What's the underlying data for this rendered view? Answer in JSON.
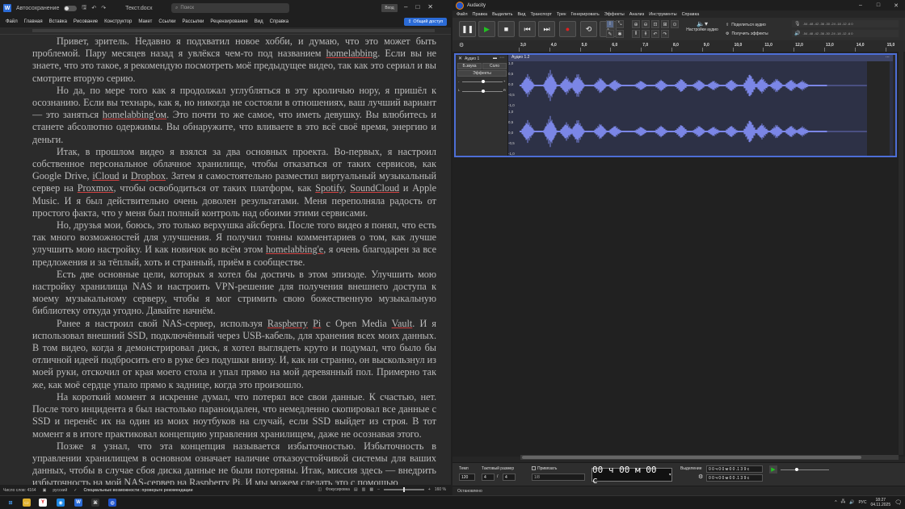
{
  "word": {
    "autosave_label": "Автосохранение",
    "doc_name": "Текст.docx",
    "search_placeholder": "Поиск",
    "signin_label": "Вход",
    "menu": [
      "Файл",
      "Главная",
      "Вставка",
      "Рисование",
      "Конструктор",
      "Макет",
      "Ссылки",
      "Рассылки",
      "Рецензирование",
      "Вид",
      "Справка"
    ],
    "share_label": "Общий доступ",
    "paragraphs": [
      [
        {
          "t": "Привет, зритель. Недавно я подхватил новое хобби, и думаю, что это может быть проблемой. Пару месяцев назад я увлёкся чем-то под названием "
        },
        {
          "t": "homelabbing",
          "s": 1
        },
        {
          "t": ". Если вы не знаете, что это такое, я рекомендую посмотреть моё предыдущее видео, так как это сериал и вы смотрите вторую серию."
        }
      ],
      [
        {
          "t": "Но да, по мере того как я продолжал углубляться в эту кроличью нору, я пришёл к осознанию. Если вы технарь, как я, но никогда не состояли в отношениях, ваш лучший вариант — это заняться "
        },
        {
          "t": "homelabbing'ом",
          "s": 1
        },
        {
          "t": ". Это почти то же самое, что иметь девушку. Вы влюбитесь и станете абсолютно одержимы. Вы обнаружите, что вливаете в это всё своё время, энергию и деньги."
        }
      ],
      [
        {
          "t": "Итак, в прошлом видео я взялся за два основных проекта. Во-первых, я настроил собственное персональное облачное хранилище, чтобы отказаться от таких сервисов, как Google Drive, "
        },
        {
          "t": "iCloud",
          "s": 1
        },
        {
          "t": " и "
        },
        {
          "t": "Dropbox",
          "s": 1
        },
        {
          "t": ". Затем я самостоятельно разместил виртуальный музыкальный сервер на "
        },
        {
          "t": "Proxmox",
          "s": 1
        },
        {
          "t": ", чтобы освободиться от таких платформ, как "
        },
        {
          "t": "Spotify",
          "s": 1
        },
        {
          "t": ", "
        },
        {
          "t": "SoundCloud",
          "s": 1
        },
        {
          "t": " и Apple Music. И я был действительно очень доволен результатами. Меня переполняла радость от простого факта, что у меня был полный контроль над обоими этими сервисами."
        }
      ],
      [
        {
          "t": "Но, друзья мои, боюсь, это только верхушка айсберга. После того видео я понял, что есть так много возможностей для улучшения. Я получил тонны комментариев о том, как лучше улучшить мою настройку. И как новичок во всём этом "
        },
        {
          "t": "homelabbing'е",
          "s": 1
        },
        {
          "t": ", я очень благодарен за все предложения и за тёплый, хоть и странный, приём в сообществе."
        }
      ],
      [
        {
          "t": "Есть две основные цели, которых я хотел бы достичь в этом эпизоде. Улучшить мою настройку хранилища NAS и настроить VPN-решение для получения внешнего доступа к моему музыкальному серверу, чтобы я мог стримить свою божественную музыкальную библиотеку откуда угодно. Давайте начнём."
        }
      ],
      [
        {
          "t": "Ранее я настроил свой NAS-сервер, используя "
        },
        {
          "t": "Raspberry",
          "s": 1
        },
        {
          "t": " "
        },
        {
          "t": "Pi",
          "s": 1
        },
        {
          "t": " с Open Media "
        },
        {
          "t": "Vault",
          "s": 1
        },
        {
          "t": ". И я использовал внешний SSD, подключённый через USB-кабель, для хранения всех моих данных. В том видео, когда я демонстрировал диск, я хотел выглядеть круто и подумал, что было бы отличной идеей подбросить его в руке без подушки внизу. И, как ни странно, он выскользнул из моей руки, отскочил от края моего стола и упал прямо на мой деревянный пол. Примерно так же, как моё сердце упало прямо к заднице, когда это произошло."
        }
      ],
      [
        {
          "t": "На короткий момент я искренне думал, что потерял все свои данные. К счастью, нет. После того инцидента я был настолько параноидален, что немедленно скопировал все данные с SSD и перенёс их на один из моих ноутбуков на случай, если SSD выйдет из строя. В тот момент я в итоге практиковал концепцию управления хранилищем, даже не осознавая этого."
        }
      ],
      [
        {
          "t": "Позже я узнал, что эта концепция называется избыточностью. Избыточность в управлении хранилищем в основном означает наличие отказоустойчивой системы для ваших данных, чтобы в случае сбоя диска данные не были потеряны. Итак, миссия здесь — внедрить избыточность на мой NAS-сервер на Raspberry Pi. И мы можем сделать это с помощью"
        }
      ]
    ],
    "status": {
      "words": "Число слов: 4164",
      "lang": "русский",
      "accessibility": "Специальные возможности: проверьте рекомендации",
      "focus": "Фокусировка",
      "zoom": "160 %"
    }
  },
  "audacity": {
    "title": "Audacity",
    "menu": [
      "Файл",
      "Правка",
      "Выделить",
      "Вид",
      "Транспорт",
      "Трек",
      "Генерировать",
      "Эффекты",
      "Анализ",
      "Инструменты",
      "Справка"
    ],
    "audio_settings": "Настройки аудио",
    "share_audio": "Поделиться аудио",
    "get_effects": "Получить эффекты",
    "meter_ticks": "-54 -48 -42 -36 -30 -24 -18 -12 -6 0",
    "timeline_ticks": [
      "3,0",
      "4,0",
      "5,0",
      "6,0",
      "7,0",
      "8,0",
      "9,0",
      "10,0",
      "11,0",
      "12,0",
      "13,0",
      "14,0",
      "15,0"
    ],
    "track": {
      "name": "Аудио 1",
      "mute": "Б.звука",
      "solo": "Соло",
      "effects": "Эффекты",
      "clip_name": "Аудио 1.2",
      "scale": [
        "1,0",
        "0,5",
        "0,0",
        "-0,5",
        "-1,0",
        "1,0",
        "0,5",
        "0,0",
        "-0,5",
        "-1,0"
      ]
    },
    "bottom": {
      "tempo_label": "Темп",
      "tempo_value": "120",
      "timesig_label": "Тактовый размер",
      "timesig_num": "4",
      "timesig_den": "4",
      "snap_label": "Привязать",
      "snap_value": "1/8",
      "time_value": "00 ч 00 м 00 с",
      "selection_label": "Выделение",
      "sel_start": "0 0 ч 0 0 м 0 0 .1 3 9 с",
      "sel_end": "0 0 ч 0 0 м 0 0 .1 3 9 с"
    },
    "status": "Остановлено"
  },
  "taskbar": {
    "lang": "РУС",
    "time": "18:27",
    "date": "04.11.2025"
  },
  "colors": {
    "accent": "#2b6bd6",
    "waveform": "#7b86e6",
    "selection_border": "#4d6ed6",
    "record": "#e02020",
    "play": "#22c022"
  }
}
